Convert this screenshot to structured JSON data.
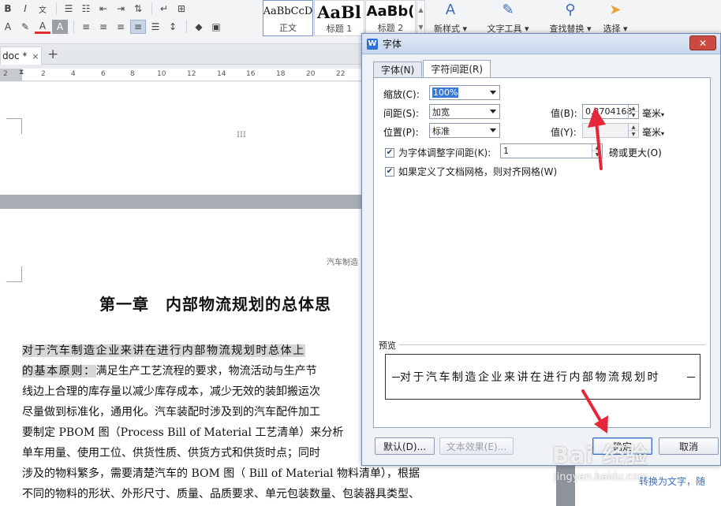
{
  "ribbon": {
    "style_gallery": [
      {
        "preview": "AaBbCcD",
        "name": "正文"
      },
      {
        "preview": "AaBl",
        "name": "标题 1"
      },
      {
        "preview": "AaBb(",
        "name": "标题 2"
      }
    ],
    "buttons": {
      "new_style": "新样式",
      "text_tools": "文字工具",
      "find_replace": "查找替换",
      "select": "选择"
    }
  },
  "document_tab": {
    "title": "doc *",
    "close_glyph": "×",
    "new_tab_glyph": "+"
  },
  "ruler": {
    "ticks": [
      "2",
      "2",
      "4",
      "6",
      "8",
      "10",
      "12",
      "14",
      "16",
      "18",
      "20",
      "22"
    ]
  },
  "document": {
    "header_mark": "III",
    "running_header": "汽车制造",
    "chapter_title": "第一章　内部物流规划的总体思",
    "paragraph_lines": [
      {
        "hl": "对于汽车制造企业来讲在进行内部物流规划时总体上",
        "rest": ""
      },
      {
        "hl": "的基本原则：",
        "rest": "满足生产工艺流程的要求，物流活动与生产节"
      },
      {
        "hl": "",
        "rest": "线边上合理的库存量以减少库存成本，减少无效的装卸搬运次"
      },
      {
        "hl": "",
        "rest": "尽量做到标准化，通用化。汽车装配时涉及到的汽车配件加工"
      },
      {
        "hl": "",
        "rest": "要制定 PBOM 图（Process Bill of Material 工艺清单）来分析"
      },
      {
        "hl": "",
        "rest": "单车用量、使用工位、供货性质、供货方式和供货时点；同时"
      },
      {
        "hl": "",
        "rest": "涉及的物料繁多，需要清楚汽车的 BOM 图（ Bill of Material 物料清单），根据"
      },
      {
        "hl": "",
        "rest": "不同的物料的形状、外形尺寸、质量、品质要求、单元包装数量、包装器具类型、"
      }
    ]
  },
  "side_panel": {
    "link_text": "转换为文字，随"
  },
  "dialog": {
    "title": "字体",
    "close_glyph": "✕",
    "tabs": [
      {
        "label": "字体(N)",
        "active": false
      },
      {
        "label": "字符间距(R)",
        "active": true
      }
    ],
    "scale": {
      "label": "缩放(C):",
      "value": "100%"
    },
    "spacing": {
      "label": "间距(S):",
      "value": "加宽",
      "value_label": "值(B):",
      "amount": "0.3704168",
      "unit": "毫米"
    },
    "position": {
      "label": "位置(P):",
      "value": "标准",
      "value_label": "值(Y):",
      "amount": "",
      "unit": "毫米"
    },
    "kerning": {
      "checked": true,
      "label": "为字体调整字间距(K):",
      "amount": "1",
      "suffix": "磅或更大(O)"
    },
    "snap_grid": {
      "checked": true,
      "label": "如果定义了文档网格，则对齐网格(W)"
    },
    "preview": {
      "label": "预览",
      "text": "对于汽车制造企业来讲在进行内部物流规划时"
    },
    "buttons": {
      "default": "默认(D)...",
      "text_effect": "文本效果(E)...",
      "ok": "确定",
      "cancel": "取消"
    }
  },
  "watermark": {
    "main": "Bai 经验",
    "sub": "jingyan.baidu.com"
  },
  "colors": {
    "accent": "#3a6cbf",
    "annotation_arrow": "#e8263a",
    "close_button": "#c94b41"
  }
}
